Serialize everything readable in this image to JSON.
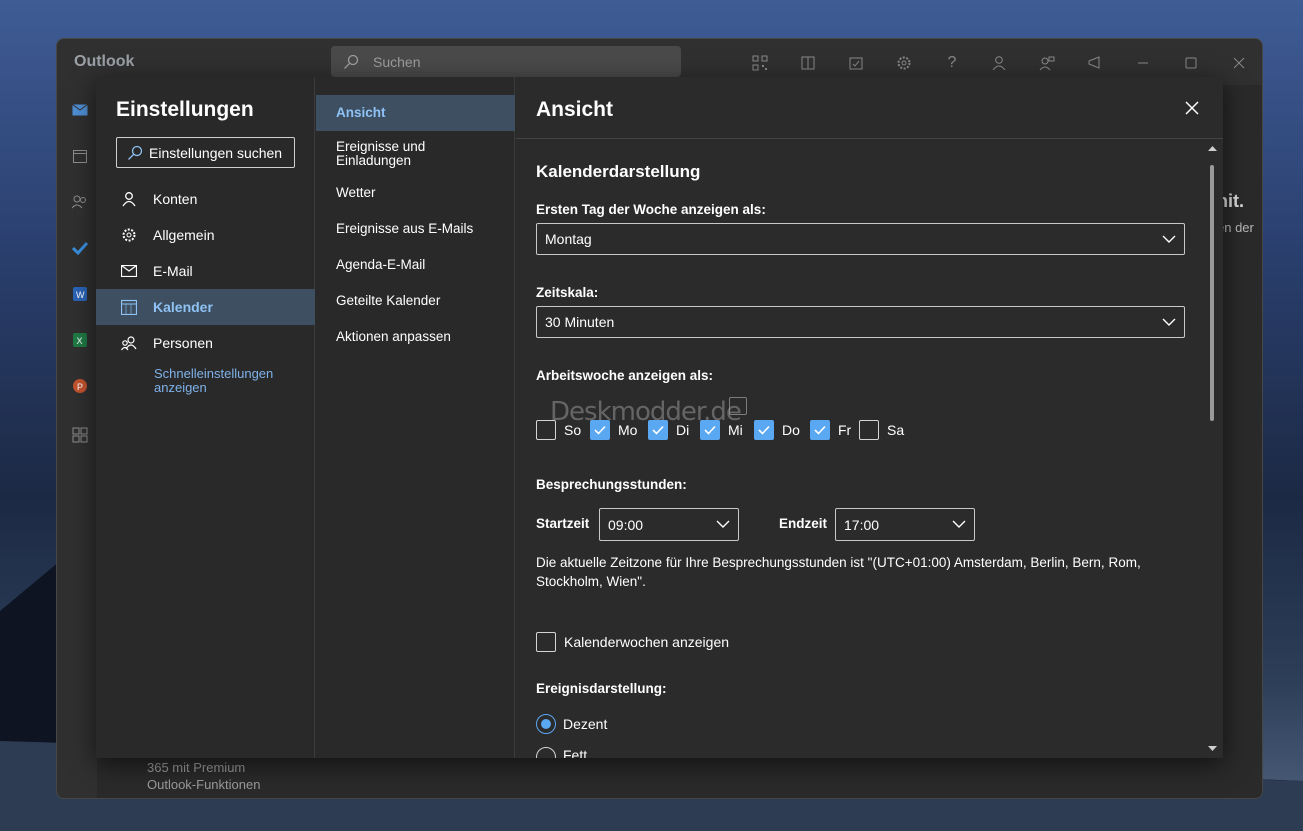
{
  "window": {
    "app_title": "Outlook",
    "search_placeholder": "Suchen"
  },
  "titlebar_icons": [
    "qr-code-icon",
    "office-icon",
    "tasks-icon",
    "gear-icon",
    "help-icon",
    "person-icon",
    "feedback-icon",
    "megaphone-icon",
    "minimize-icon",
    "maximize-icon",
    "close-icon"
  ],
  "background": {
    "premium_line1": "365 mit Premium",
    "premium_line2": "Outlook-Funktionen",
    "right_heading": "nit.",
    "right_text": "en der"
  },
  "settings": {
    "title": "Einstellungen",
    "search_label": "Einstellungen suchen",
    "nav": [
      {
        "label": "Konten",
        "icon": "person-icon"
      },
      {
        "label": "Allgemein",
        "icon": "gear-icon"
      },
      {
        "label": "E-Mail",
        "icon": "mail-icon"
      },
      {
        "label": "Kalender",
        "icon": "calendar-icon",
        "selected": true
      },
      {
        "label": "Personen",
        "icon": "people-icon"
      }
    ],
    "quick_settings": "Schnelleinstellungen anzeigen",
    "subnav": [
      {
        "label": "Ansicht",
        "selected": true
      },
      {
        "label": "Ereignisse und Einladungen"
      },
      {
        "label": "Wetter"
      },
      {
        "label": "Ereignisse aus E-Mails"
      },
      {
        "label": "Agenda-E-Mail"
      },
      {
        "label": "Geteilte Kalender"
      },
      {
        "label": "Aktionen anpassen"
      }
    ]
  },
  "panel": {
    "title": "Ansicht",
    "section_title": "Kalenderdarstellung",
    "first_day_label": "Ersten Tag der Woche anzeigen als:",
    "first_day_value": "Montag",
    "timescale_label": "Zeitskala:",
    "timescale_value": "30 Minuten",
    "workweek_label": "Arbeitswoche anzeigen als:",
    "days": [
      {
        "label": "So",
        "checked": false
      },
      {
        "label": "Mo",
        "checked": true
      },
      {
        "label": "Di",
        "checked": true
      },
      {
        "label": "Mi",
        "checked": true
      },
      {
        "label": "Do",
        "checked": true
      },
      {
        "label": "Fr",
        "checked": true
      },
      {
        "label": "Sa",
        "checked": false
      }
    ],
    "meeting_hours_label": "Besprechungsstunden:",
    "start_label": "Startzeit",
    "start_value": "09:00",
    "end_label": "Endzeit",
    "end_value": "17:00",
    "timezone_info": "Die aktuelle Zeitzone für Ihre Besprechungsstunden ist \"(UTC+01:00) Amsterdam, Berlin, Bern, Rom, Stockholm, Wien\".",
    "week_numbers_label": "Kalenderwochen anzeigen",
    "week_numbers_checked": false,
    "event_display_label": "Ereignisdarstellung:",
    "event_options": [
      {
        "label": "Dezent",
        "selected": true
      },
      {
        "label": "Fett",
        "selected": false
      }
    ]
  },
  "watermark": "Deskmodder.de",
  "colors": {
    "accent": "#5aa7f2",
    "selected_bg": "#3d4f60",
    "link": "#7fb2ea"
  }
}
